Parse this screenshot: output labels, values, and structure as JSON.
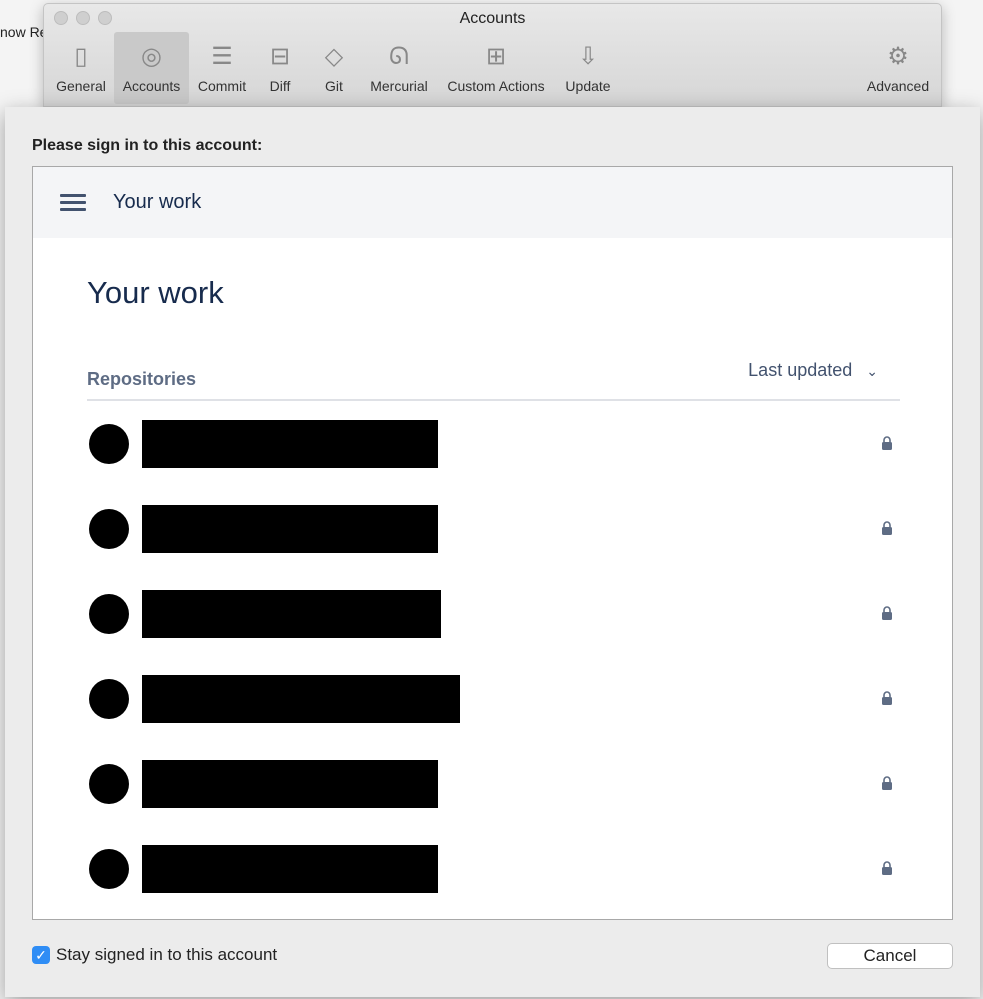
{
  "background": {
    "text": "now Re"
  },
  "window": {
    "title": "Accounts"
  },
  "toolbar": [
    {
      "label": "General",
      "icon": "switch-icon"
    },
    {
      "label": "Accounts",
      "icon": "user-icon",
      "selected": true
    },
    {
      "label": "Commit",
      "icon": "document-icon"
    },
    {
      "label": "Diff",
      "icon": "diff-icon"
    },
    {
      "label": "Git",
      "icon": "git-icon"
    },
    {
      "label": "Mercurial",
      "icon": "mercurial-icon"
    },
    {
      "label": "Custom Actions",
      "icon": "flowchart-icon"
    },
    {
      "label": "Update",
      "icon": "download-icon"
    },
    {
      "label": "Advanced",
      "icon": "gear-icon"
    }
  ],
  "sheet": {
    "prompt": "Please sign in to this account:",
    "web": {
      "header_title": "Your work",
      "page_title": "Your work",
      "section": "Repositories",
      "sort": "Last updated",
      "repositories": [
        {
          "private": true
        },
        {
          "private": true
        },
        {
          "private": true
        },
        {
          "private": true
        },
        {
          "private": true
        },
        {
          "private": true
        }
      ]
    },
    "stay_signed_in": {
      "label": "Stay signed in to this account",
      "checked": true
    },
    "cancel": "Cancel"
  }
}
